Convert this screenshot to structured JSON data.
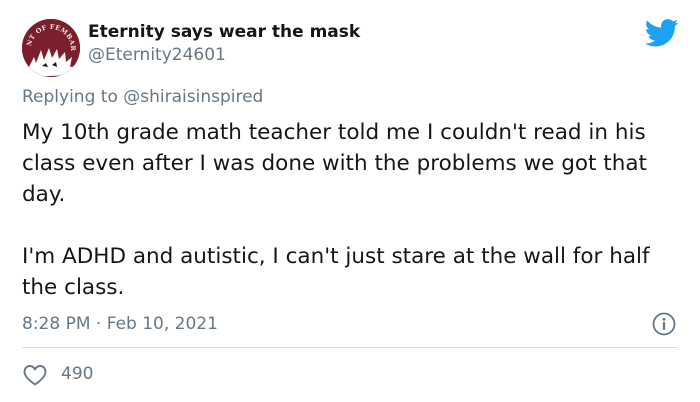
{
  "tweet": {
    "display_name": "Eternity says wear the mask",
    "handle": "@Eternity24601",
    "replying_prefix": "Replying to",
    "replying_to": "@shiraisinspired",
    "paragraphs": [
      "My 10th grade math teacher told me I couldn't read in his class even after I was done with the problems we got that day.",
      "I'm ADHD and autistic, I can't just stare at the wall for half the class."
    ],
    "time": "8:28 PM",
    "separator": "·",
    "date": "Feb 10, 2021",
    "likes": "490",
    "avatar_text": "TENT OF FEMBARR"
  },
  "icons": {
    "brand": "twitter-bird-icon",
    "info": "info-icon",
    "like": "heart-icon"
  },
  "colors": {
    "twitter_blue": "#1da1f2",
    "secondary_text": "#657786",
    "primary_text": "#14171a",
    "avatar_bg": "#7a1f2b"
  }
}
